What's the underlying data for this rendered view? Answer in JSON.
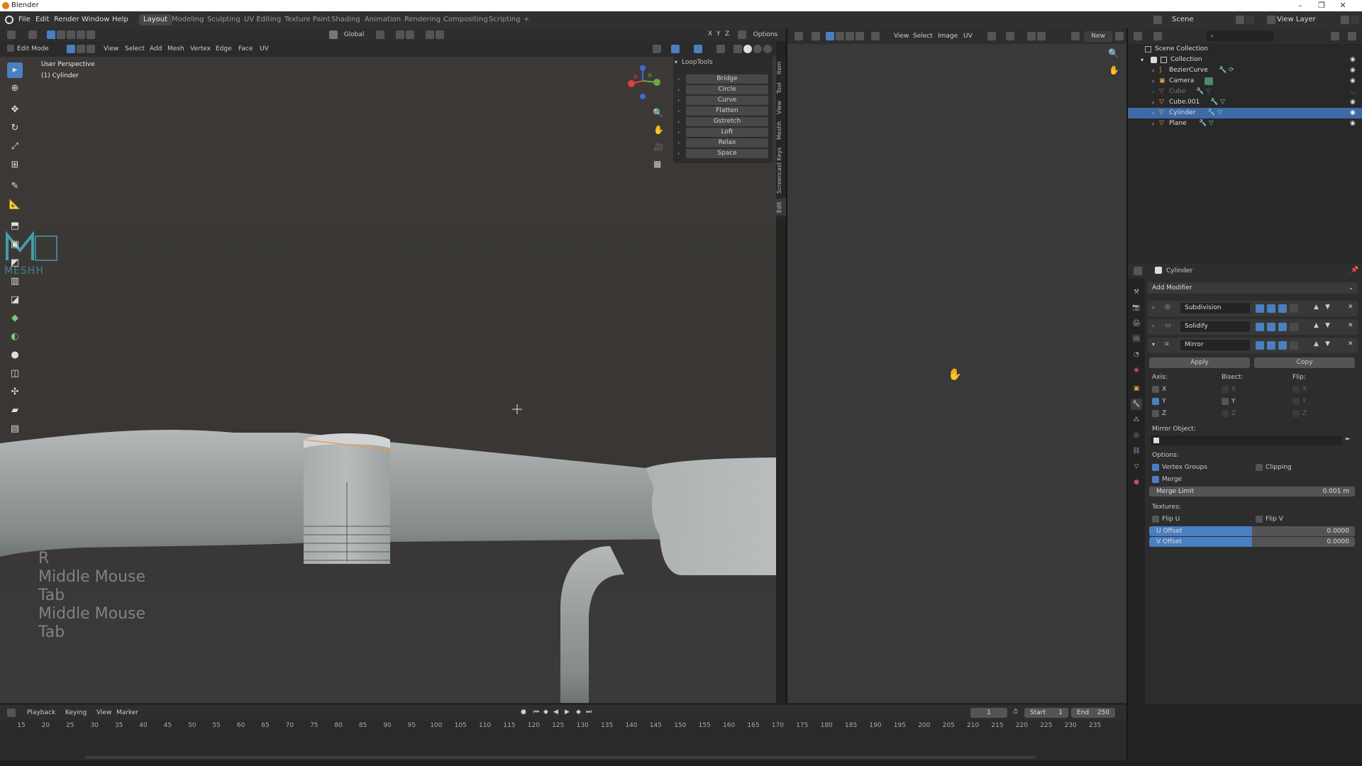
{
  "window": {
    "title": "Blender"
  },
  "menu": [
    "File",
    "Edit",
    "Render",
    "Window",
    "Help"
  ],
  "workspaces": [
    {
      "label": "Layout",
      "active": true
    },
    {
      "label": "Modeling"
    },
    {
      "label": "Sculpting"
    },
    {
      "label": "UV Editing"
    },
    {
      "label": "Texture Paint"
    },
    {
      "label": "Shading"
    },
    {
      "label": "Animation"
    },
    {
      "label": "Rendering"
    },
    {
      "label": "Compositing"
    },
    {
      "label": "Scripting"
    }
  ],
  "scene": {
    "label": "Scene",
    "view_layer": "View Layer"
  },
  "viewport_header": {
    "transform": "Global",
    "options": "Options",
    "mode": "Edit Mode",
    "menus": [
      "View",
      "Select",
      "Add",
      "Mesh",
      "Vertex",
      "Edge",
      "Face",
      "UV"
    ]
  },
  "viewport": {
    "perspective": "User Perspective",
    "object": "(1) Cylinder",
    "watermark": "MESHH",
    "keys": [
      "R",
      "Middle Mouse",
      "Tab",
      "Middle Mouse",
      "Tab"
    ]
  },
  "looptools": {
    "title": "LoopTools",
    "items": [
      "Bridge",
      "Circle",
      "Curve",
      "Flatten",
      "Gstretch",
      "Loft",
      "Relax",
      "Space"
    ]
  },
  "side_tabs": [
    "Item",
    "Tool",
    "View",
    "Meshh",
    "Screencast Keys",
    "Edit"
  ],
  "image_editor": {
    "menus": [
      "View",
      "Select",
      "Image",
      "UV"
    ],
    "new_label": "New"
  },
  "outliner": {
    "root": "Scene Collection",
    "collection": "Collection",
    "items": [
      "BezierCurve",
      "Camera",
      "Cube",
      "Cube.001",
      "Cylinder",
      "Plane"
    ],
    "selected": "Cylinder"
  },
  "properties": {
    "object": "Cylinder",
    "add_modifier": "Add Modifier",
    "modifiers": [
      "Subdivision",
      "Solidify",
      "Mirror"
    ],
    "apply": "Apply",
    "copy": "Copy",
    "axis_label": "Axis:",
    "bisect_label": "Bisect:",
    "flip_label": "Flip:",
    "axes": [
      "X",
      "Y",
      "Z"
    ],
    "axis_checked": [
      false,
      true,
      false
    ],
    "mirror_object": "Mirror Object:",
    "options_label": "Options:",
    "vertex_groups": "Vertex Groups",
    "clipping": "Clipping",
    "merge": "Merge",
    "merge_limit_label": "Merge Limit",
    "merge_limit_value": "0.001 m",
    "textures_label": "Textures:",
    "flip_u": "Flip U",
    "flip_v": "Flip V",
    "u_offset_label": "U Offset",
    "u_offset_value": "0.0000",
    "v_offset_label": "V Offset",
    "v_offset_value": "0.0000"
  },
  "timeline": {
    "menus": [
      "Playback",
      "Keying",
      "View",
      "Marker"
    ],
    "current_frame": "1",
    "start_label": "Start",
    "start": "1",
    "end_label": "End",
    "end": "250",
    "ticks": [
      "15",
      "20",
      "25",
      "30",
      "35",
      "40",
      "45",
      "50",
      "55",
      "60",
      "65",
      "70",
      "75",
      "80",
      "85",
      "90",
      "95",
      "100",
      "105",
      "110",
      "115",
      "120",
      "125",
      "130",
      "135",
      "140",
      "145",
      "150",
      "155",
      "160",
      "165",
      "170",
      "175",
      "180",
      "185",
      "190",
      "195",
      "200",
      "205",
      "210",
      "215",
      "220",
      "225",
      "230",
      "235"
    ]
  }
}
